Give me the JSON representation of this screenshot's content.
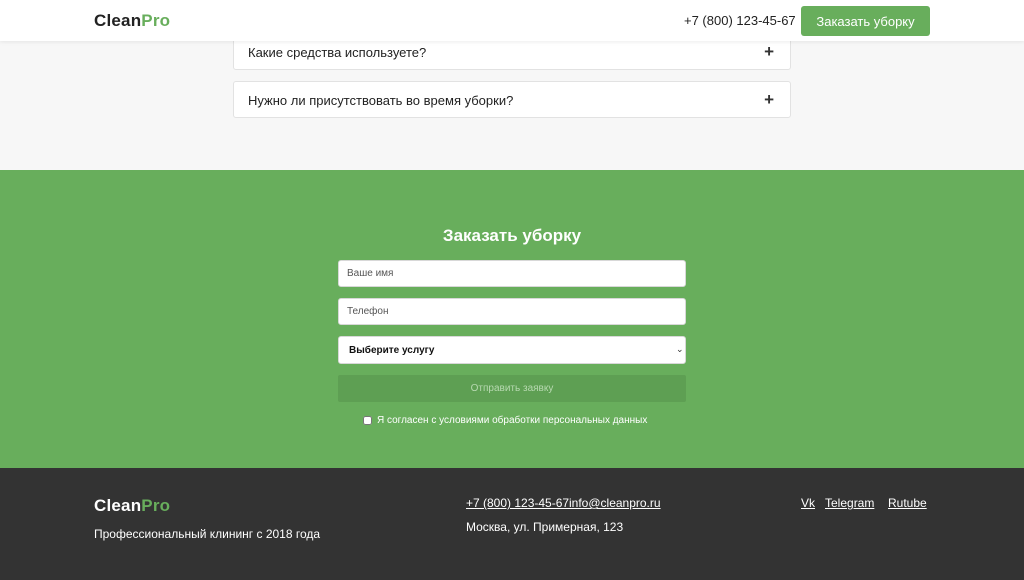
{
  "brand": {
    "name_part1": "Clean",
    "name_part2": "Pro",
    "accent_color": "#68ae5c"
  },
  "header": {
    "phone": "+7 (800) 123-45-67",
    "cta_label": "Заказать уборку"
  },
  "faq": {
    "items": [
      {
        "question": "Какие средства используете?",
        "icon": "plus-icon"
      },
      {
        "question": "Нужно ли присутствовать во время уборки?",
        "icon": "plus-icon"
      }
    ]
  },
  "order_form": {
    "title": "Заказать уборку",
    "name_placeholder": "Ваше имя",
    "name_value": "",
    "phone_placeholder": "Телефон",
    "phone_value": "",
    "service_selected": "Выберите услугу",
    "submit_label": "Отправить заявку",
    "consent_label": "Я согласен с условиями обработки персональных данных",
    "consent_checked": false,
    "background_color": "#68ae5c"
  },
  "footer": {
    "tagline": "Профессиональный клининг с 2018 года",
    "phone": "+7 (800) 123-45-67",
    "email": "info@cleanpro.ru",
    "address": "Москва, ул. Примерная, 123",
    "social": [
      "Vk",
      "Telegram",
      "Rutube"
    ],
    "background_color": "#333333"
  }
}
